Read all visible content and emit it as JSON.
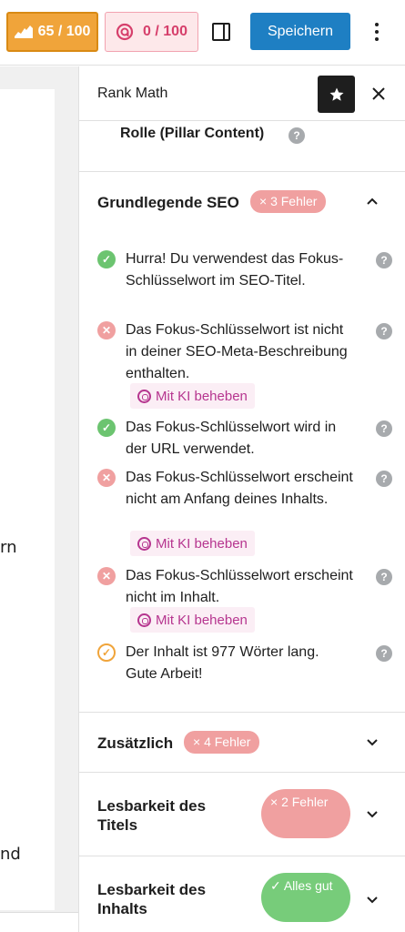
{
  "toolbar": {
    "seo_score": "65 / 100",
    "ai_score": "0 / 100",
    "save_label": "Speichern"
  },
  "editor": {
    "fragment_1": "rn",
    "fragment_2": "nd"
  },
  "sidebar": {
    "title": "Rank Math",
    "pillar_label": "Rolle (Pillar Content)",
    "basic_seo": {
      "title": "Grundlegende SEO",
      "badge": "× 3 Fehler",
      "checks": [
        {
          "status": "ok",
          "text": "Hurra! Du verwendest das Fokus-Schlüsselwort im SEO-Titel."
        },
        {
          "status": "fail",
          "text": "Das Fokus-Schlüsselwort ist nicht in deiner SEO-Meta-Beschreibung enthalten.",
          "ai_fix": "Mit KI beheben"
        },
        {
          "status": "ok",
          "text": "Das Fokus-Schlüsselwort wird in der URL verwendet."
        },
        {
          "status": "fail",
          "text": "Das Fokus-Schlüsselwort erscheint nicht am Anfang deines Inhalts.",
          "ai_fix": "Mit KI beheben"
        },
        {
          "status": "fail",
          "text": "Das Fokus-Schlüsselwort erscheint nicht im Inhalt.",
          "ai_fix": "Mit KI beheben"
        },
        {
          "status": "warn",
          "text": "Der Inhalt ist 977 Wörter lang. Gute Arbeit!"
        }
      ]
    },
    "additional": {
      "title": "Zusätzlich",
      "badge": "× 4 Fehler"
    },
    "title_readability": {
      "title": "Lesbarkeit des Titels",
      "badge": "× 2 Fehler"
    },
    "content_readability": {
      "title": "Lesbarkeit des Inhalts",
      "badge": "✓ Alles gut"
    }
  },
  "colors": {
    "seo_score_bg": "#f0a43a",
    "primary": "#1e7fc3",
    "ok": "#6cc470",
    "fail": "#f0a0a0",
    "ai": "#b6358f"
  }
}
